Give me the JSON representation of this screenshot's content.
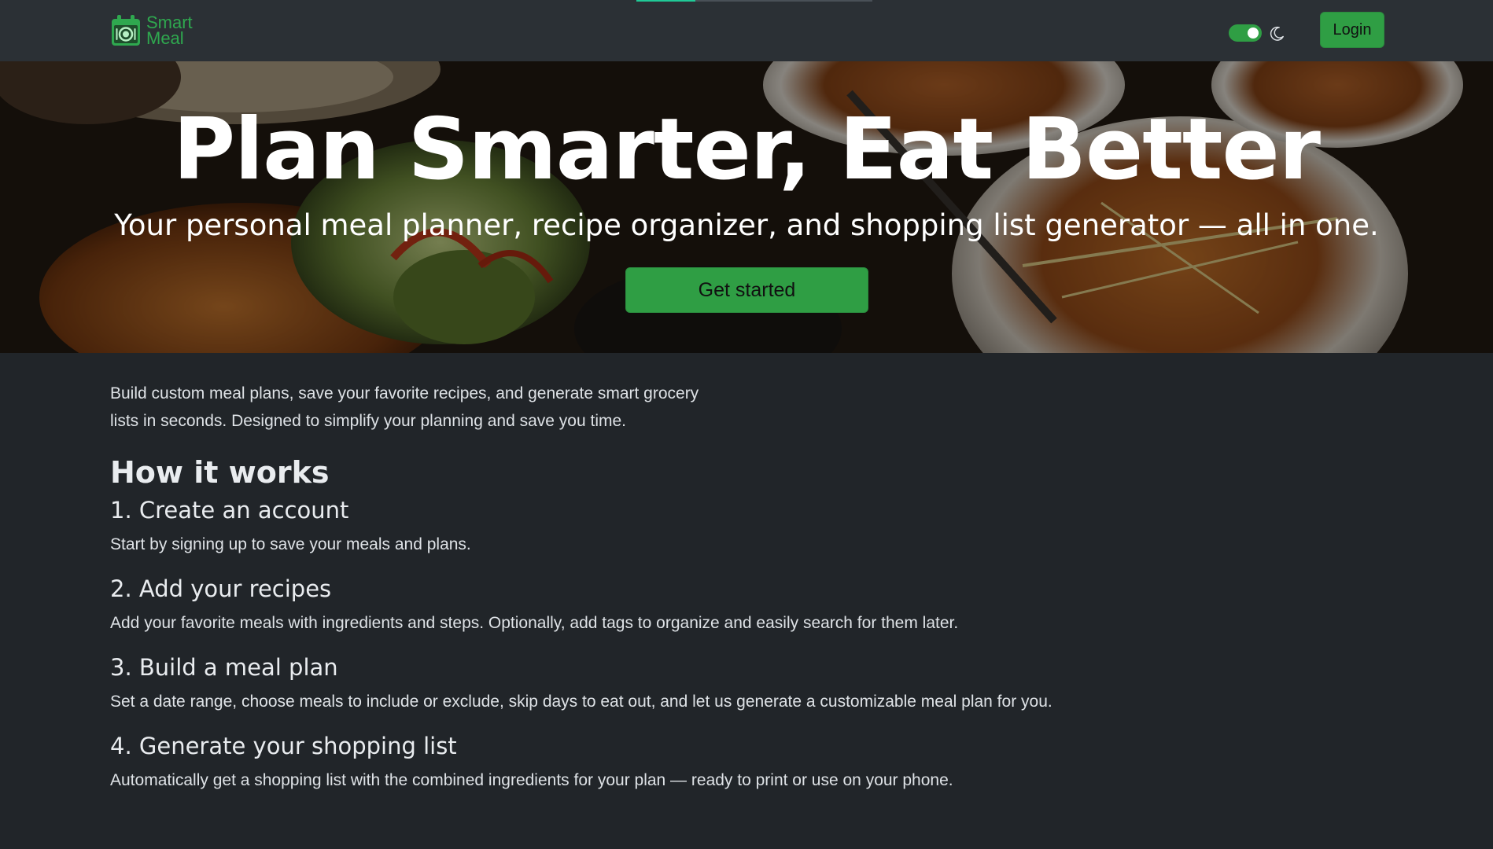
{
  "nav": {
    "brand_line1": "Smart",
    "brand_line2": "Meal",
    "login_label": "Login",
    "theme_toggle_on": true,
    "page_progress": 0.25
  },
  "hero": {
    "title": "Plan Smarter, Eat Better",
    "subtitle": "Your personal meal planner, recipe organizer, and shopping list generator — all in one.",
    "cta_label": "Get started"
  },
  "main": {
    "intro": "Build custom meal plans, save your favorite recipes, and generate smart grocery lists in seconds. Designed to simplify your planning and save you time.",
    "how_title": "How it works",
    "steps": [
      {
        "title": "1. Create an account",
        "desc": "Start by signing up to save your meals and plans."
      },
      {
        "title": "2. Add your recipes",
        "desc": "Add your favorite meals with ingredients and steps. Optionally, add tags to organize and easily search for them later."
      },
      {
        "title": "3. Build a meal plan",
        "desc": "Set a date range, choose meals to include or exclude, skip days to eat out, and let us generate a customizable meal plan for you."
      },
      {
        "title": "4. Generate your shopping list",
        "desc": "Automatically get a shopping list with the combined ingredients for your plan — ready to print or use on your phone."
      }
    ]
  },
  "colors": {
    "accent": "#2f9e44",
    "background": "#212529",
    "navbar": "#2b3035"
  },
  "icons": [
    "calendar-plate-logo-icon",
    "moon-icon"
  ]
}
